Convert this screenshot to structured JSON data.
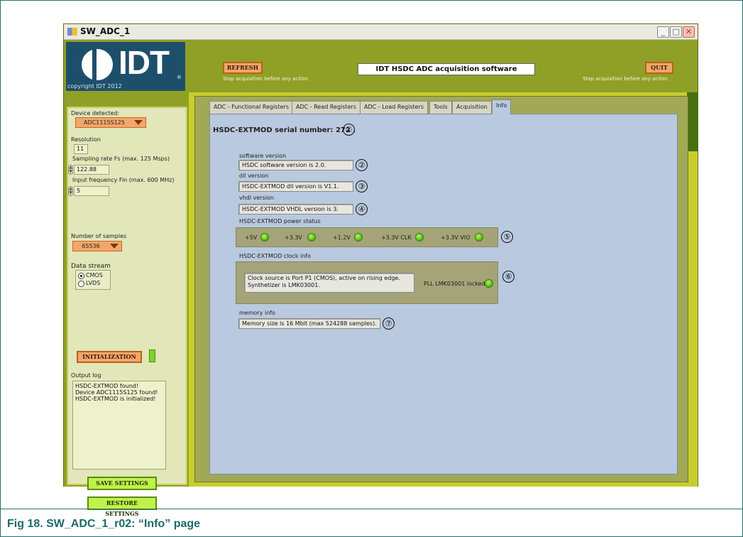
{
  "window": {
    "title": "SW_ADC_1",
    "copyright": "copyright IDT 2012",
    "logo_text": "IDT"
  },
  "header": {
    "refresh_label": "REFRESH",
    "refresh_hint": "Stop acquisition before any action.",
    "app_title": "IDT  HSDC ADC acquisition software",
    "quit_label": "QUIT",
    "quit_hint": "Stop acquisition before any action."
  },
  "sidebar": {
    "device_label": "Device detected:",
    "device_value": "ADC1115S125",
    "resolution_label": "Resolution",
    "resolution_value": "11",
    "sampling_label": "Sampling rate Fs (max. 125 Msps)",
    "sampling_value": "122.88",
    "input_freq_label": "Input frequency Fin (max. 600 MHz)",
    "input_freq_value": "5",
    "samples_label": "Number of samples",
    "samples_value": "65536",
    "data_stream_label": "Data stream",
    "data_stream_options": [
      "CMOS",
      "LVDS"
    ],
    "data_stream_selected": "CMOS",
    "init_label": "INITIALIZATION",
    "output_log_label": "Output log",
    "output_log": [
      "HSDC-EXTMOD found!",
      "Device ADC1115S125 found!",
      "HSDC-EXTMOD is initialized!"
    ],
    "save_label": "SAVE SETTINGS",
    "restore_label": "RESTORE SETTINGS"
  },
  "tabs": [
    "ADC - Functional Registers",
    "ADC - Read Registers",
    "ADC - Load Registers",
    "Tools",
    "Acquisition",
    "Info"
  ],
  "active_tab": "Info",
  "info": {
    "serial_label": "HSDC-EXTMOD serial number: 272 .",
    "software_version_label": "software version",
    "software_version_value": "HSDC software version is 2.0.",
    "dll_version_label": "dll version",
    "dll_version_value": "HSDC-EXTMOD dll version is V1.1.",
    "vhdl_version_label": "vhdl version",
    "vhdl_version_value": "HSDC-EXTMOD VHDL version is 3.",
    "power_status_label": "HSDC-EXTMOD power status",
    "power_rails": [
      "+5V",
      "+3.3V",
      "+1.2V",
      "+3.3V CLK",
      "+3.3V VIO"
    ],
    "clock_info_label": "HSDC-EXTMOD clock info",
    "clock_info_lines": [
      "Clock source is Port P1 (CMOS), active on rising edge.",
      "Synthetizer is LMK03001."
    ],
    "pll_label": "PLL LMK03001 locked",
    "memory_info_label": "memory info",
    "memory_info_value": "Memory size is 16 Mbit (max 524288 samples)."
  },
  "callouts": [
    "①",
    "②",
    "③",
    "④",
    "⑤",
    "⑥",
    "⑦"
  ],
  "caption": "Fig 18.  SW_ADC_1_r02: “Info” page"
}
